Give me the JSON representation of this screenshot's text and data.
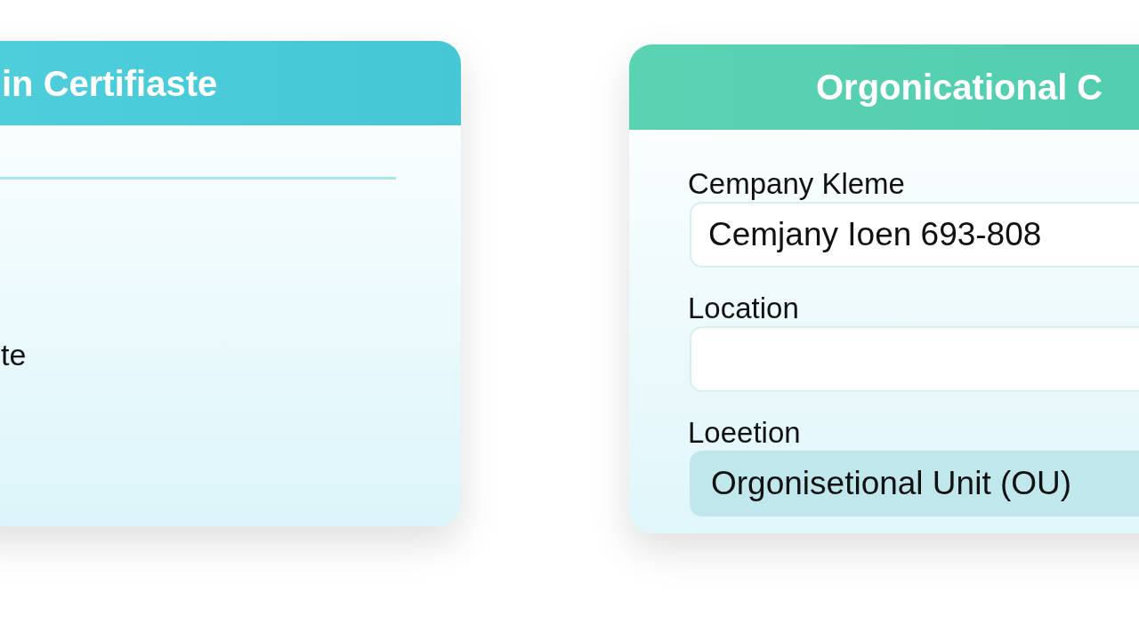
{
  "left_panel": {
    "title": "in Certifiaste",
    "text": "te"
  },
  "right_panel": {
    "title": "Orgonicational C",
    "fields": [
      {
        "label": "Cempany Kleme",
        "value": "Cemjany Ioen 693-808",
        "highlighted": false
      },
      {
        "label": "Location",
        "highlighted": false
      },
      {
        "label": "Loeetion",
        "value": "Orgonisetional Unit (OU)",
        "highlighted": true
      }
    ]
  }
}
